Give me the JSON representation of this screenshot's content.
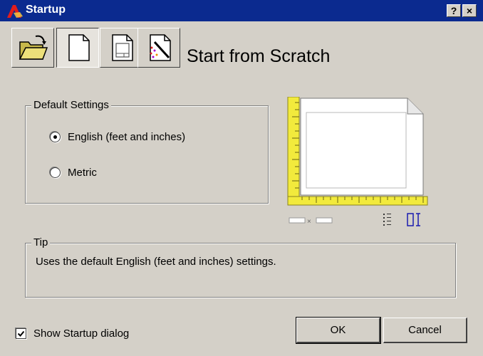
{
  "window": {
    "title": "Startup",
    "help_label": "?",
    "close_label": "×"
  },
  "toolbar": {
    "buttons": [
      {
        "name": "open-drawing",
        "icon": "open-folder-icon"
      },
      {
        "name": "start-from-scratch",
        "icon": "blank-page-icon",
        "pressed": true
      },
      {
        "name": "use-template",
        "icon": "template-page-icon"
      },
      {
        "name": "use-wizard",
        "icon": "wizard-page-icon"
      }
    ]
  },
  "heading": "Start from Scratch",
  "default_settings": {
    "legend": "Default Settings",
    "options": [
      {
        "label": "English (feet and inches)",
        "checked": true
      },
      {
        "label": "Metric",
        "checked": false
      }
    ]
  },
  "tip": {
    "legend": "Tip",
    "text": "Uses the default English (feet and inches) settings."
  },
  "show_startup": {
    "label": "Show Startup dialog",
    "checked": true
  },
  "buttons": {
    "ok": "OK",
    "cancel": "Cancel"
  },
  "colors": {
    "titlebar": "#0b2a8f",
    "ruler": "#f2ea3c",
    "face": "#d4d0c8"
  }
}
